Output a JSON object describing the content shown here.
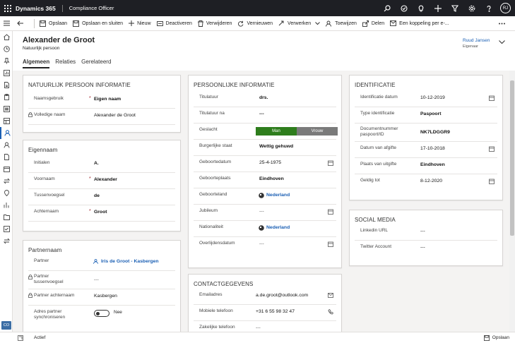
{
  "topbar": {
    "brand": "Dynamics 365",
    "app": "Compliance Officer",
    "avatar_initials": "RJ"
  },
  "commands": [
    {
      "label": "Opslaan",
      "icon": "save-icon"
    },
    {
      "label": "Opslaan en sluiten",
      "icon": "save-close-icon"
    },
    {
      "label": "Nieuw",
      "icon": "plus-icon"
    },
    {
      "label": "Deactiveren",
      "icon": "deactivate-icon"
    },
    {
      "label": "Verwijderen",
      "icon": "trash-icon"
    },
    {
      "label": "Vernieuwen",
      "icon": "refresh-icon"
    },
    {
      "label": "Verwerken",
      "icon": "process-icon"
    },
    {
      "label": "Toewijzen",
      "icon": "assign-icon"
    },
    {
      "label": "Delen",
      "icon": "share-icon"
    },
    {
      "label": "Een koppeling per e-...",
      "icon": "email-link-icon"
    }
  ],
  "record": {
    "title": "Alexander de Groot",
    "subtitle": "Natuurlijk persoon",
    "owner": "Ruud Jansen",
    "owner_label": "Eigenaar"
  },
  "tabs": [
    "Algemeen",
    "Relaties",
    "Gerelateerd"
  ],
  "sections": {
    "natuurlijk": {
      "title": "NATUURLIJK PERSOON INFORMATIE",
      "fields": [
        {
          "label": "Naamsgebruik",
          "value": "Eigen naam"
        },
        {
          "label": "Volledige naam",
          "value": "Alexander de Groot"
        }
      ]
    },
    "eigennaam": {
      "title": "Eigennaam",
      "fields": [
        {
          "label": "Initialen",
          "value": "A."
        },
        {
          "label": "Voornaam",
          "value": "Alexander"
        },
        {
          "label": "Tussenvoegsel",
          "value": "de"
        },
        {
          "label": "Achternaam",
          "value": "Groot"
        }
      ]
    },
    "partnernaam": {
      "title": "Partnernaam",
      "fields": [
        {
          "label": "Partner",
          "value": "Iris de Groot - Kasbergen"
        },
        {
          "label": "Partner tussenvoegsel",
          "value": "---"
        },
        {
          "label": "Partner achternaam",
          "value": "Kasbergen"
        },
        {
          "label": "Adres partner synchroniseren",
          "value": "Nee"
        }
      ]
    },
    "persoonlijk": {
      "title": "PERSOONLIJKE INFORMATIE",
      "fields": [
        {
          "label": "Titulatuur",
          "value": "drs."
        },
        {
          "label": "Titulatuur na",
          "value": "---"
        },
        {
          "label": "Geslacht",
          "option_a": "Man",
          "option_b": "Vrouw"
        },
        {
          "label": "Burgerlijke staat",
          "value": "Wettig gehuwd"
        },
        {
          "label": "Geboortedatum",
          "value": "25-4-1975"
        },
        {
          "label": "Geboorteplaats",
          "value": "Eindhoven"
        },
        {
          "label": "Geboorteland",
          "value": "Nederland"
        },
        {
          "label": "Jubileum",
          "value": "---"
        },
        {
          "label": "Nationaliteit",
          "value": "Nederland"
        },
        {
          "label": "Overlijdensdatum",
          "value": "---"
        }
      ]
    },
    "contact": {
      "title": "CONTACTGEGEVENS",
      "fields": [
        {
          "label": "Emailadres",
          "value": "a.de.groot@outlook.com"
        },
        {
          "label": "Mobiele telefoon",
          "value": "+31 6 55 98 32 47"
        },
        {
          "label": "Zakelijke telefoon",
          "value": "---"
        }
      ]
    },
    "identificatie": {
      "title": "IDENTIFICATIE",
      "fields": [
        {
          "label": "Identificatie datum",
          "value": "10-12-2019"
        },
        {
          "label": "Type identificatie",
          "value": "Paspoort"
        },
        {
          "label": "Documentnummer paspoort/ID",
          "value": "NK7LDGGR9"
        },
        {
          "label": "Datum van afgifte",
          "value": "17-10-2018"
        },
        {
          "label": "Plaats van uitgifte",
          "value": "Eindhoven"
        },
        {
          "label": "Geldig tot",
          "value": "8-12-2020"
        }
      ]
    },
    "social": {
      "title": "SOCIAL MEDIA",
      "fields": [
        {
          "label": "Linkedin URL",
          "value": "---"
        },
        {
          "label": "Twitter Account",
          "value": "---"
        }
      ]
    }
  },
  "status": {
    "text": "Actief",
    "save_label": "Opslaan",
    "badge": "CO"
  },
  "colors": {
    "topbar": "#1e1f24",
    "gender_selected": "#2e7d1c",
    "gender_unselected": "#7a7a7a",
    "link": "#1a5fb4",
    "required": "#a4262c"
  }
}
